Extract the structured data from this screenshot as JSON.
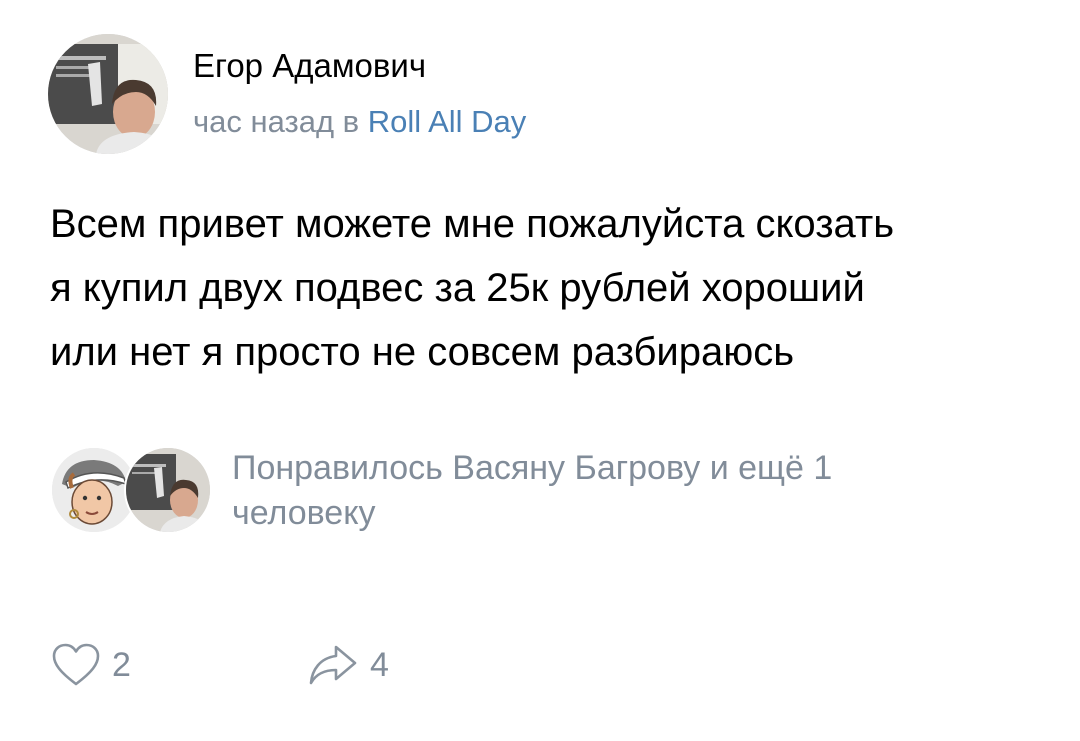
{
  "post": {
    "author": {
      "name": "Егор Адамович",
      "avatar_icon": "user-photo"
    },
    "meta": {
      "time": "час назад в",
      "group": "Roll All Day"
    },
    "text_lines": [
      "Всем привет можете мне пожалуйста скозать",
      "я купил двух подвес за 25к рублей хороший",
      "или нет я просто не совсем разбираюсь"
    ],
    "likes": {
      "text_lines": [
        "Понравилось Васяну Багрову и ещё 1",
        "человеку"
      ]
    },
    "actions": {
      "like": {
        "icon": "heart-icon",
        "count": "2"
      },
      "share": {
        "icon": "share-arrow-icon",
        "count": "4"
      }
    }
  },
  "colors": {
    "secondary_text": "#818c99",
    "link": "#4a80b5"
  }
}
